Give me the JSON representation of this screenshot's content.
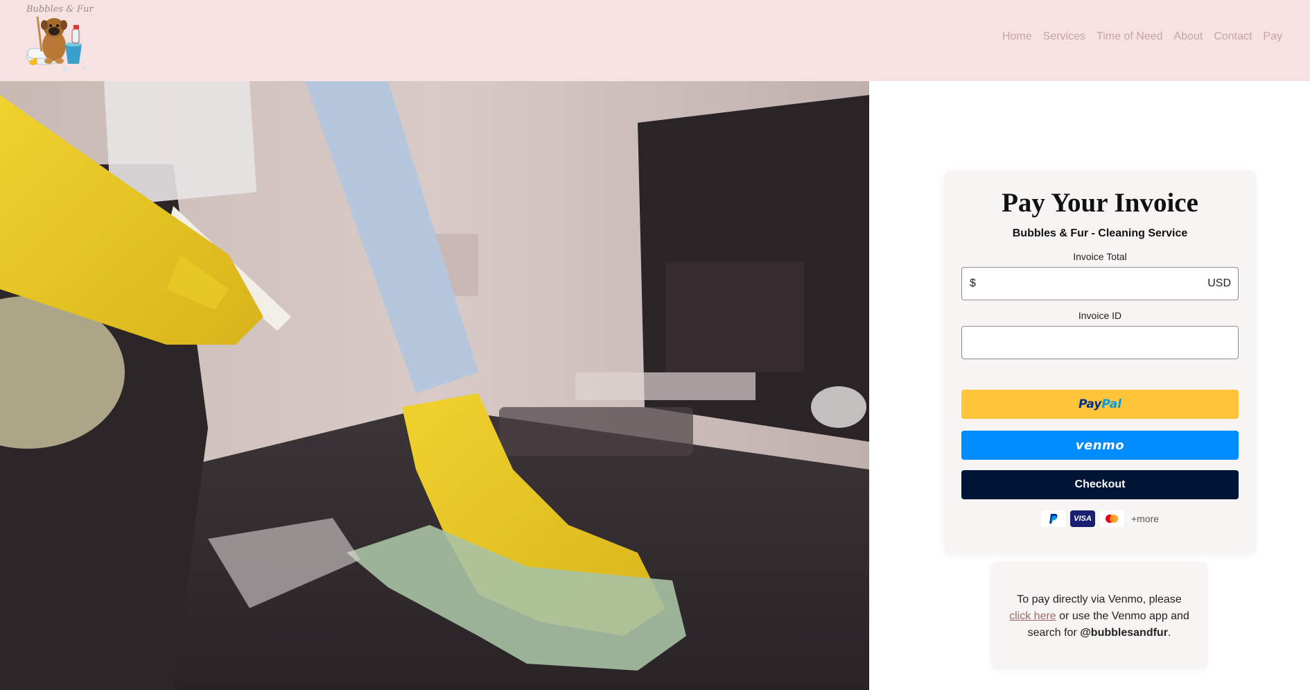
{
  "header": {
    "logo_text": "Bubbles & Fur",
    "nav": [
      "Home",
      "Services",
      "Time of Need",
      "About",
      "Contact",
      "Pay"
    ],
    "background": "#f7e2e3",
    "nav_color": "#c7a3a6"
  },
  "payment": {
    "title": "Pay Your Invoice",
    "subtitle": "Bubbles & Fur - Cleaning Service",
    "invoice_total_label": "Invoice Total",
    "currency_symbol": "$",
    "currency_code": "USD",
    "invoice_total_value": "",
    "invoice_id_label": "Invoice ID",
    "invoice_id_value": "",
    "paypal_label_1": "Pay",
    "paypal_label_2": "Pal",
    "venmo_label": "venmo",
    "checkout_label": "Checkout",
    "card_marks": [
      "paypal-icon",
      "visa-icon",
      "mastercard-icon"
    ],
    "visa_text": "VISA",
    "more_label": "+more",
    "colors": {
      "paypal": "#ffc439",
      "venmo": "#008cff",
      "checkout": "#001435"
    }
  },
  "venmo_info": {
    "text_before": "To pay directly via Venmo, please",
    "link_text": "click here",
    "text_middle": "or use the Venmo app and search for",
    "handle": "@bubblesandfur",
    "text_end": "."
  }
}
